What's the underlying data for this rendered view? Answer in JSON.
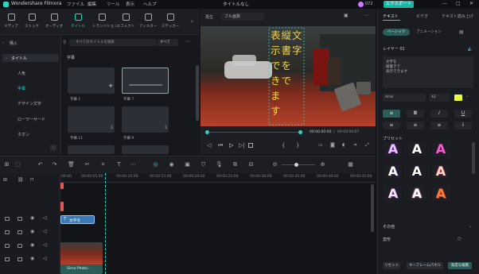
{
  "app": {
    "title": "Wondershare Filmora",
    "menu": [
      "ファイル",
      "編集",
      "ツール",
      "表示",
      "ヘルプ"
    ],
    "doc_title": "タイトルなし",
    "export_label": "エクスポート",
    "badge": "072"
  },
  "media_tabs": [
    "メディア",
    "ストック",
    "オーディオ",
    "タイトル",
    "トランジション",
    "エフェクト",
    "フィルター",
    "ステッカー"
  ],
  "sidebar": {
    "items": [
      {
        "label": "購入",
        "icon": "chevron-right-icon"
      },
      {
        "label": "タイトル",
        "icon": "chevron-down-icon"
      },
      {
        "label": "人気"
      },
      {
        "label": "字幕"
      },
      {
        "label": "デザイン文字"
      },
      {
        "label": "ローワーサード"
      },
      {
        "label": "タオン"
      }
    ]
  },
  "library": {
    "search_placeholder": "すべてのタイトルを検索",
    "filter_value": "すべて",
    "section": "字幕",
    "tiles": [
      {
        "label": "字幕 1"
      },
      {
        "label": "字幕 7"
      },
      {
        "label": "字幕 11"
      },
      {
        "label": "字幕 9"
      }
    ]
  },
  "player": {
    "quality": "フル画質",
    "time_current": "00:00:00:00",
    "time_total": "00:00:00:07",
    "overlay_text_lines": [
      "表縦文",
      "示書字",
      "でを",
      "きで",
      "ま",
      "す"
    ]
  },
  "right_panel": {
    "tabs": [
      "テキスト",
      "ビデオ",
      "テキスト読み上げ"
    ],
    "subtabs": [
      "ベーシック",
      "アニメーション"
    ],
    "layer_label": "レイヤー 01",
    "text_value": [
      "文字を",
      "縦書きで",
      "表示できます"
    ],
    "font": "Arial",
    "font_size": "42",
    "preset_label": "プリセット",
    "more_label": "その他",
    "transform_label": "変形",
    "reset_label": "リセット",
    "keyframe_label": "キーフレームパネル",
    "advanced_label": "高度な編集"
  },
  "timeline": {
    "ruler": [
      "00:00",
      "00:00:05:00",
      "00:00:10:00",
      "00:00:15:00",
      "00:00:20:00",
      "00:00:25:00",
      "00:00:30:00",
      "00:00:35:00",
      "00:00:40:00",
      "00:00:45:00"
    ],
    "clip_title": "文字を",
    "clip_video": "Sirne Photo..."
  },
  "colors": {
    "accent": "#2fd3c0",
    "overlay_text": "#f5d83a",
    "highlight": "#e5ff3a"
  }
}
